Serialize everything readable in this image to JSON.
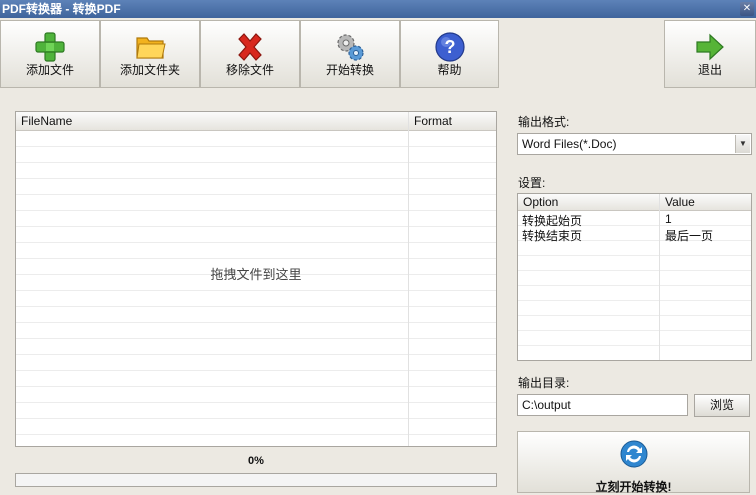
{
  "window": {
    "title": "PDF转换器 - 转换PDF",
    "close_glyph": "✕"
  },
  "toolbar": {
    "add_file": "添加文件",
    "add_folder": "添加文件夹",
    "remove_file": "移除文件",
    "start_convert": "开始转换",
    "help": "帮助",
    "exit": "退出"
  },
  "file_list": {
    "columns": [
      "FileName",
      "Format"
    ],
    "hint": "拖拽文件到这里",
    "rows": []
  },
  "progress": {
    "text": "0%",
    "value": 0
  },
  "output_format": {
    "label": "输出格式:",
    "selected": "Word Files(*.Doc)"
  },
  "settings": {
    "label": "设置:",
    "columns": [
      "Option",
      "Value"
    ],
    "rows": [
      {
        "option": "转换起始页",
        "value": "1"
      },
      {
        "option": "转换结束页",
        "value": "最后一页"
      }
    ]
  },
  "output_dir": {
    "label": "输出目录:",
    "value": "C:\\output",
    "browse": "浏览"
  },
  "start_now": {
    "label": "立刻开始转换!"
  },
  "colors": {
    "accent": "#3f649c",
    "add_green": "#4fb33b",
    "remove_red": "#d8281e",
    "help_blue": "#3d5fd0",
    "exit_green": "#56b437"
  }
}
